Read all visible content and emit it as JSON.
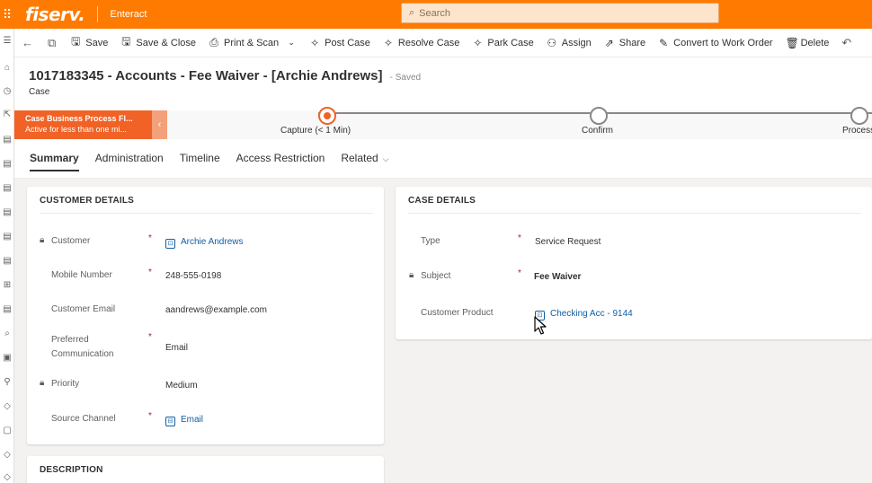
{
  "topbar": {
    "brand": "fiserv.",
    "app_name": "Enteract",
    "search_placeholder": "Search"
  },
  "commands": [
    {
      "icon": "save-icon",
      "label": "Save"
    },
    {
      "icon": "save-close-icon",
      "label": "Save & Close"
    },
    {
      "icon": "print-icon",
      "label": "Print & Scan"
    },
    {
      "icon": "post-case-icon",
      "label": "Post Case"
    },
    {
      "icon": "resolve-case-icon",
      "label": "Resolve Case"
    },
    {
      "icon": "park-case-icon",
      "label": "Park Case"
    },
    {
      "icon": "assign-icon",
      "label": "Assign"
    },
    {
      "icon": "share-icon",
      "label": "Share"
    },
    {
      "icon": "convert-icon",
      "label": "Convert to Work Order"
    },
    {
      "icon": "delete-icon",
      "label": "Delete"
    }
  ],
  "header": {
    "title": "1017183345 - Accounts - Fee Waiver - [Archie Andrews]",
    "save_status": "- Saved",
    "entity": "Case"
  },
  "bpf": {
    "name": "Case Business Process Fl...",
    "status": "Active for less than one mi...",
    "stages": [
      {
        "label": "Capture  (< 1 Min)",
        "active": true
      },
      {
        "label": "Confirm",
        "active": false
      },
      {
        "label": "Process",
        "active": false
      }
    ]
  },
  "tabs": [
    "Summary",
    "Administration",
    "Timeline",
    "Access Restriction",
    "Related"
  ],
  "customer_details": {
    "title": "CUSTOMER DETAILS",
    "customer_label": "Customer",
    "customer_value": "Archie Andrews",
    "mobile_label": "Mobile Number",
    "mobile_value": "248-555-0198",
    "email_label": "Customer Email",
    "email_value": "aandrews@example.com",
    "pref_label_1": "Preferred",
    "pref_label_2": "Communication",
    "pref_value": "Email",
    "priority_label": "Priority",
    "priority_value": "Medium",
    "source_label": "Source Channel",
    "source_value": "Email"
  },
  "case_details": {
    "title": "CASE DETAILS",
    "type_label": "Type",
    "type_value": "Service Request",
    "subject_label": "Subject",
    "subject_value": "Fee Waiver",
    "product_label": "Customer Product",
    "product_value": "Checking Acc - 9144"
  },
  "description": {
    "title": "DESCRIPTION"
  },
  "colors": {
    "brand": "#ff7a00",
    "bpf_flag": "#f06225",
    "link": "#115ea3",
    "required": "#a4262c"
  }
}
